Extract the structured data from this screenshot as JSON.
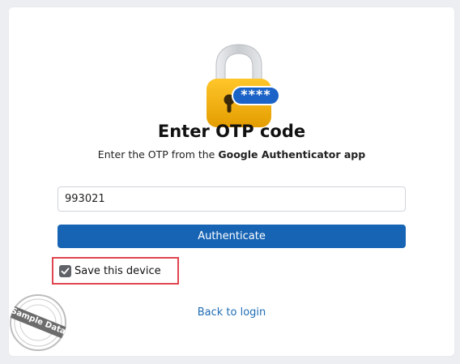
{
  "header": {
    "title": "Enter OTP code",
    "subtitle_prefix": "Enter the OTP from the ",
    "subtitle_app": "Google Authenticator app"
  },
  "lock_icon": {
    "masked_text": "****",
    "colors": {
      "body": "#f5b301",
      "shackle": "#d7d9dc",
      "badge": "#1c63c7"
    }
  },
  "otp": {
    "value": "993021",
    "placeholder": ""
  },
  "authenticate_button": {
    "label": "Authenticate",
    "color": "#1764b4"
  },
  "save_device": {
    "label": "Save this device",
    "checked": true,
    "highlight_color": "#e0454f"
  },
  "back_link": {
    "label": "Back to login"
  },
  "watermark": {
    "text": "Sample Data"
  }
}
